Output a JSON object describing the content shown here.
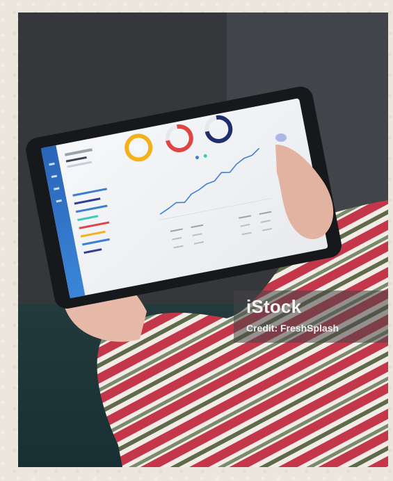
{
  "image": {
    "watermark": {
      "logo": "iStock",
      "credit": "Credit: FreshSplash"
    }
  },
  "colors": {
    "dashboard_sidebar": "#2f6fc3",
    "ring_yellow": "#f2b21c",
    "ring_red": "#e04545",
    "ring_navy": "#1f2f6e",
    "line_chart": "#3a7fd0",
    "sweater_red": "#c4364a",
    "sweater_green": "#5f6a4a"
  }
}
